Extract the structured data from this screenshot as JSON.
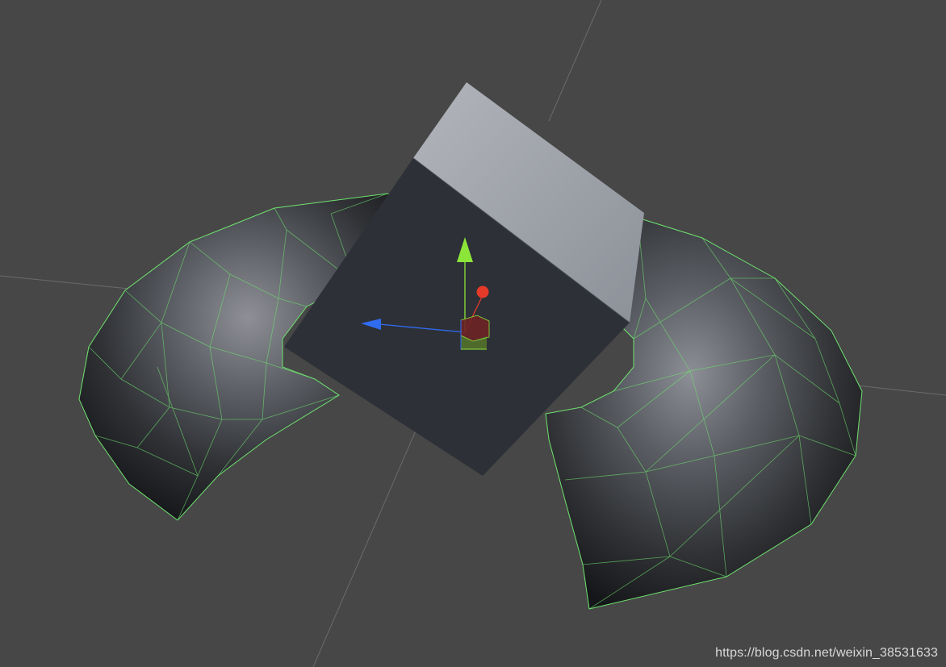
{
  "scene": {
    "background_color": "#474747",
    "grid_line_color": "#6a6a6a",
    "mesh_color": "#2f2f31",
    "wireframe_color": "#6fe36f",
    "cube_front_color": "#2d3037",
    "cube_top_color": "#9ca0a7"
  },
  "gizmo": {
    "x_axis_color": "#e53a2a",
    "y_axis_color": "#8ce63a",
    "z_axis_color": "#2f6cf0"
  },
  "watermark": {
    "text": "https://blog.csdn.net/weixin_38531633",
    "color": "#d8d8d8"
  }
}
